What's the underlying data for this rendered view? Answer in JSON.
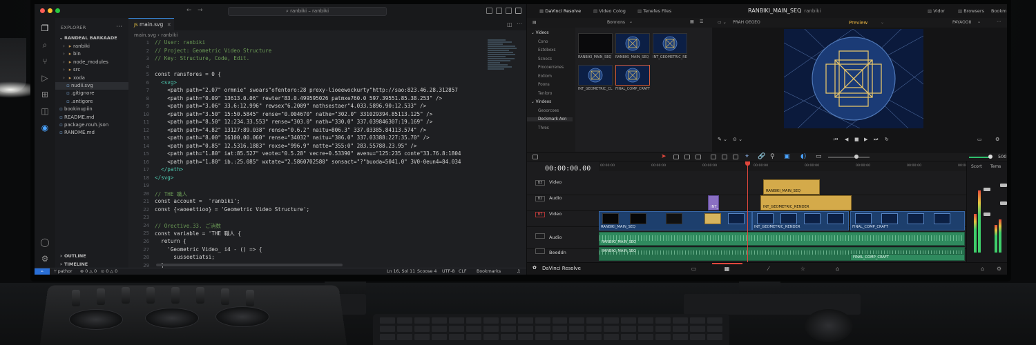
{
  "vscode": {
    "title": "ranbiki – ranbiki",
    "tab": "main.svg",
    "tab_prefix": "JS",
    "breadcrumb": "main.svg  ›  ranbiki",
    "explorer": {
      "header": "EXPLORER",
      "root": "RANDEAL BARKAADE",
      "items": [
        {
          "label": "ranbiki",
          "icon": "folder-icon"
        },
        {
          "label": "bin",
          "icon": "folder-icon"
        },
        {
          "label": "node_modules",
          "icon": "folder-icon"
        },
        {
          "label": "src",
          "icon": "folder-icon"
        },
        {
          "label": "xoda",
          "icon": "folder-icon"
        },
        {
          "label": "nudii.svg",
          "icon": "file-icon"
        },
        {
          "label": ".gitignore",
          "icon": "file-icon"
        },
        {
          "label": ".antigore",
          "icon": "file-icon"
        },
        {
          "label": "bookinupiin",
          "icon": "file-icon"
        },
        {
          "label": "README.md",
          "icon": "file-icon"
        },
        {
          "label": "package.rouh.json",
          "icon": "file-icon"
        },
        {
          "label": "RANDME.md",
          "icon": "file-icon"
        }
      ],
      "outline": "OUTLINE",
      "timeline": "TIMELINE"
    },
    "code_lines": [
      {
        "n": "1",
        "text": "// User: ranbiki",
        "cls": "c-com"
      },
      {
        "n": "2",
        "text": "// Project: Geometric Video Structure",
        "cls": "c-com"
      },
      {
        "n": "3",
        "text": "// Key: Structure, Code, Edit.",
        "cls": "c-com"
      },
      {
        "n": "4",
        "text": "",
        "cls": ""
      },
      {
        "n": "5",
        "text": "const ransfores = 0 {",
        "cls": ""
      },
      {
        "n": "6",
        "text": "  <svg>",
        "cls": "c-tag"
      },
      {
        "n": "7",
        "text": "    <path path=\"2.07\" ormnie\" swoars\"ofentoro:28 prexy-lioeewockurty\"http://sao:823.46.28.312857",
        "cls": ""
      },
      {
        "n": "8",
        "text": "    <path path=\"0.09\" 13613.0.06\" rewter\"83.0.499595026 patmxe760.0 597.39551.85.38.253\" />",
        "cls": ""
      },
      {
        "n": "9",
        "text": "    <path path=\"3.06\" 33.6:12.996\" rewsex\"6.2009\" nathsestaer\"4.033.5896.90:12.533\" />",
        "cls": ""
      },
      {
        "n": "10",
        "text": "    <path path=\"3.50\" 15:50.5845\" rense=\"0.004670\" nathe=\"302.0\" 331029394.85113.125\" />",
        "cls": ""
      },
      {
        "n": "11",
        "text": "    <path path=\"8.50\" 12:234.33.553\" rense=\"303.0\" nath=\"330.0\" 337.039846307:19.169\" />",
        "cls": ""
      },
      {
        "n": "12",
        "text": "    <path path=\"4.82\" 13127:89.038\" rense=\"0.6.2\" naitu=806.3\" 337.03385.84113.574\" />",
        "cls": ""
      },
      {
        "n": "13",
        "text": "    <path path=\"8.00\" 16100.00.060\" rense=\"34032\" naitu=\"306.0\" 337.03388:227:35.70\" />",
        "cls": ""
      },
      {
        "n": "14",
        "text": "    <path path=\"0.85\" 12.5316.1883\" roxse=\"996.9\" natte=\"355:0\" 283.55788.23.95\" />",
        "cls": ""
      },
      {
        "n": "15",
        "text": "    <path path=\"1.80\" iat:85.527\" veote=\"0.5.28\" vecre+0.53390\" avenu=\"125:235 conte\"33.76.8:1804",
        "cls": ""
      },
      {
        "n": "16",
        "text": "    <path path=\"1.80\" ib.:25.085\" wxtate=\"2.5860702580\" sonsact=\"?\"buoda=5041.0\" 3V0-0eun4=84.034",
        "cls": ""
      },
      {
        "n": "17",
        "text": "  </path>",
        "cls": "c-tag"
      },
      {
        "n": "18",
        "text": "</svg>",
        "cls": "c-tag"
      },
      {
        "n": "19",
        "text": "",
        "cls": ""
      },
      {
        "n": "20",
        "text": "// THE 職人",
        "cls": "c-com"
      },
      {
        "n": "21",
        "text": "const account =  'ranbiki';",
        "cls": ""
      },
      {
        "n": "22",
        "text": "const {«aoeettioo} = 'Geometric Video Structure';",
        "cls": ""
      },
      {
        "n": "23",
        "text": "",
        "cls": ""
      },
      {
        "n": "24",
        "text": "// Orective.33. ご消数",
        "cls": "c-com"
      },
      {
        "n": "25",
        "text": "const variable = 'THE 職人 {",
        "cls": ""
      },
      {
        "n": "26",
        "text": "  return {",
        "cls": ""
      },
      {
        "n": "27",
        "text": "    'Geometric Video_ i4 - () => {",
        "cls": ""
      },
      {
        "n": "28",
        "text": "      susseetiatsi;",
        "cls": ""
      },
      {
        "n": "29",
        "text": "  }",
        "cls": ""
      }
    ],
    "status": {
      "branch": "pathor",
      "problems": "⊗ 0 △ 0",
      "info": "⊙ 0 △ 0",
      "position": "Ln 16, Sol 11",
      "spaces": "Scoose 4",
      "encoding": "UTF-8",
      "eol": "CLF",
      "mode": "Bookmarks"
    }
  },
  "resolve": {
    "top_tabs": [
      "DaVinci Resolve",
      "Video Colog",
      "Tenefes Files"
    ],
    "project": "RANBIKI_MAIN_SEQ",
    "project_user": "ranbiki",
    "top_right": [
      "Vidor",
      "Browsers",
      "Bookmark"
    ],
    "pool_header": "Bonnons",
    "bins": [
      {
        "label": "Videos",
        "sel": false,
        "head": true
      },
      {
        "label": "Cono",
        "sel": false
      },
      {
        "label": "Estoboxs",
        "sel": false
      },
      {
        "label": "Scnocs",
        "sel": false
      },
      {
        "label": "Procoerrenes",
        "sel": false
      },
      {
        "label": "Eotiom",
        "sel": false
      },
      {
        "label": "Poons",
        "sel": false
      },
      {
        "label": "Tenloro",
        "sel": false
      },
      {
        "label": "Vindeos",
        "sel": false,
        "head": true
      },
      {
        "label": "Geoorcoes",
        "sel": false
      },
      {
        "label": "Deckmark Aon",
        "sel": true
      },
      {
        "label": "Thres",
        "sel": false
      }
    ],
    "clips": [
      {
        "label": "RANBIKI_MAIN_SEQ",
        "sel": false
      },
      {
        "label": "RANBIKI_MAIN_SEQ",
        "sel": false
      },
      {
        "label": "INT_GEOMETRIC_RE...",
        "sel": false
      },
      {
        "label": "INT_GEOMETRIC_CL...",
        "sel": false
      },
      {
        "label": "FINAL_COMP_CRAFT",
        "sel": true
      }
    ],
    "viewer_left": "PRAH OEGEO",
    "viewer_title": "Preview",
    "viewer_right": "PAYAOO8",
    "timecode": "00:00:00.00",
    "ruler_ticks": [
      "00:00:00",
      "00:00:00",
      "00:00:00",
      "00:00:00",
      "00:00:00",
      "00:00:00",
      "00:00:00",
      "00:00:00"
    ],
    "tracks": [
      {
        "num": "B3",
        "label": "Video",
        "red": false
      },
      {
        "num": "B2",
        "label": "Audio",
        "red": false
      },
      {
        "num": "B7",
        "label": "Video",
        "red": true
      },
      {
        "num": "",
        "label": "Audio",
        "red": false
      },
      {
        "num": "",
        "label": "Beeddn",
        "red": false
      }
    ],
    "timeline_clips": {
      "v3_top": "RANBIKI_MAIN_SEQ",
      "v2_small": "INT_",
      "v2_mid": "INT_GEOMETRIC_RENDER",
      "v1_a": "RANBIKI_MAIN_SEQ",
      "v1_b": "INT_GEOMETRIC_RENDER",
      "v1_c": "FINAL_COMP_CRAFT",
      "a1_a": "RANBIKI_MAIN_SEQ",
      "a2_a": "RANBIKI_MAIN_SEQ",
      "a2_b": "FINAL_COMP_CRAFT"
    },
    "mixer": {
      "tab1": "Scort",
      "tab2": "Tems"
    },
    "volume": "500",
    "app_name": "DaVinci Resolve"
  }
}
